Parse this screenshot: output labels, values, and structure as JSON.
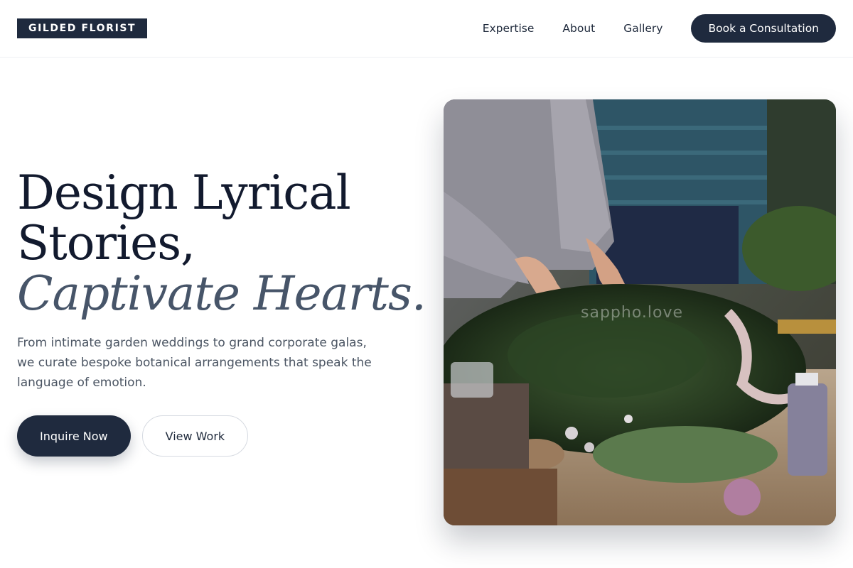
{
  "brand": {
    "logo_text": "GILDED FLORIST"
  },
  "nav": {
    "links": [
      "Expertise",
      "About",
      "Gallery"
    ],
    "cta_label": "Book a Consultation"
  },
  "hero": {
    "headline_line1": "Design Lyrical",
    "headline_line2": "Stories,",
    "headline_accent": "Captivate Hearts.",
    "description": "From intimate garden weddings to grand corporate galas, we curate bespoke botanical arrangements that speak the language of emotion.",
    "primary_button": "Inquire Now",
    "secondary_button": "View Work",
    "image_watermark": "sappho.love"
  },
  "colors": {
    "primary_navy": "#1f2a3e",
    "accent_slate": "#475569",
    "body_text": "#4b5563"
  }
}
